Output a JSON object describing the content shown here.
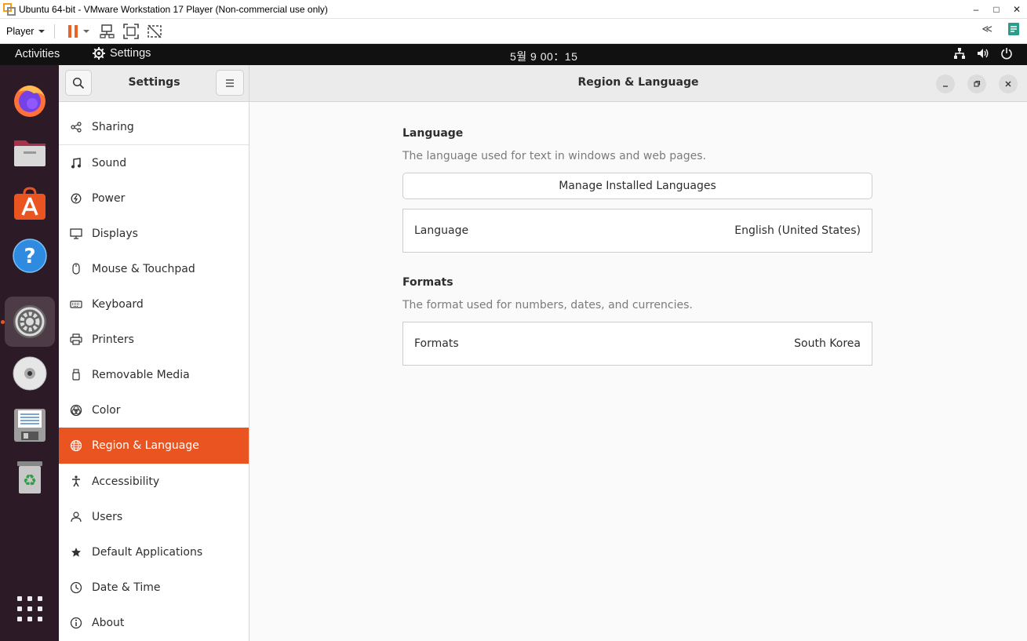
{
  "vm": {
    "title": "Ubuntu 64-bit - VMware Workstation 17 Player (Non-commercial use only)",
    "player_label": "Player",
    "min_glyph": "–",
    "max_glyph": "□",
    "close_glyph": "✕",
    "collapse_glyph": "≪",
    "accent_color": "#e9622a"
  },
  "topbar": {
    "activities": "Activities",
    "app_name": "Settings",
    "clock": "5월 9  00：15"
  },
  "dock": {
    "items": [
      "firefox-icon",
      "files-icon",
      "app-center-icon",
      "help-icon",
      "settings-icon",
      "disc-icon",
      "save-disk-icon",
      "trash-icon"
    ],
    "active_item": "settings-icon"
  },
  "sidebar": {
    "title": "Settings",
    "items": [
      {
        "label": "Sharing",
        "icon": "share-icon"
      },
      {
        "label": "Sound",
        "icon": "music-note-icon"
      },
      {
        "label": "Power",
        "icon": "power-icon"
      },
      {
        "label": "Displays",
        "icon": "display-icon"
      },
      {
        "label": "Mouse & Touchpad",
        "icon": "mouse-icon"
      },
      {
        "label": "Keyboard",
        "icon": "keyboard-icon"
      },
      {
        "label": "Printers",
        "icon": "printer-icon"
      },
      {
        "label": "Removable Media",
        "icon": "usb-icon"
      },
      {
        "label": "Color",
        "icon": "color-icon"
      },
      {
        "label": "Region & Language",
        "icon": "globe-icon",
        "selected": true
      },
      {
        "label": "Accessibility",
        "icon": "accessibility-icon"
      },
      {
        "label": "Users",
        "icon": "users-icon"
      },
      {
        "label": "Default Applications",
        "icon": "star-icon"
      },
      {
        "label": "Date & Time",
        "icon": "clock-icon"
      },
      {
        "label": "About",
        "icon": "info-icon"
      }
    ],
    "selected_color": "#e95420"
  },
  "main": {
    "title": "Region & Language",
    "language_section": {
      "title": "Language",
      "description": "The language used for text in windows and web pages.",
      "manage_button": "Manage Installed Languages",
      "row_label": "Language",
      "row_value": "English (United States)"
    },
    "formats_section": {
      "title": "Formats",
      "description": "The format used for numbers, dates, and currencies.",
      "row_label": "Formats",
      "row_value": "South Korea"
    }
  }
}
